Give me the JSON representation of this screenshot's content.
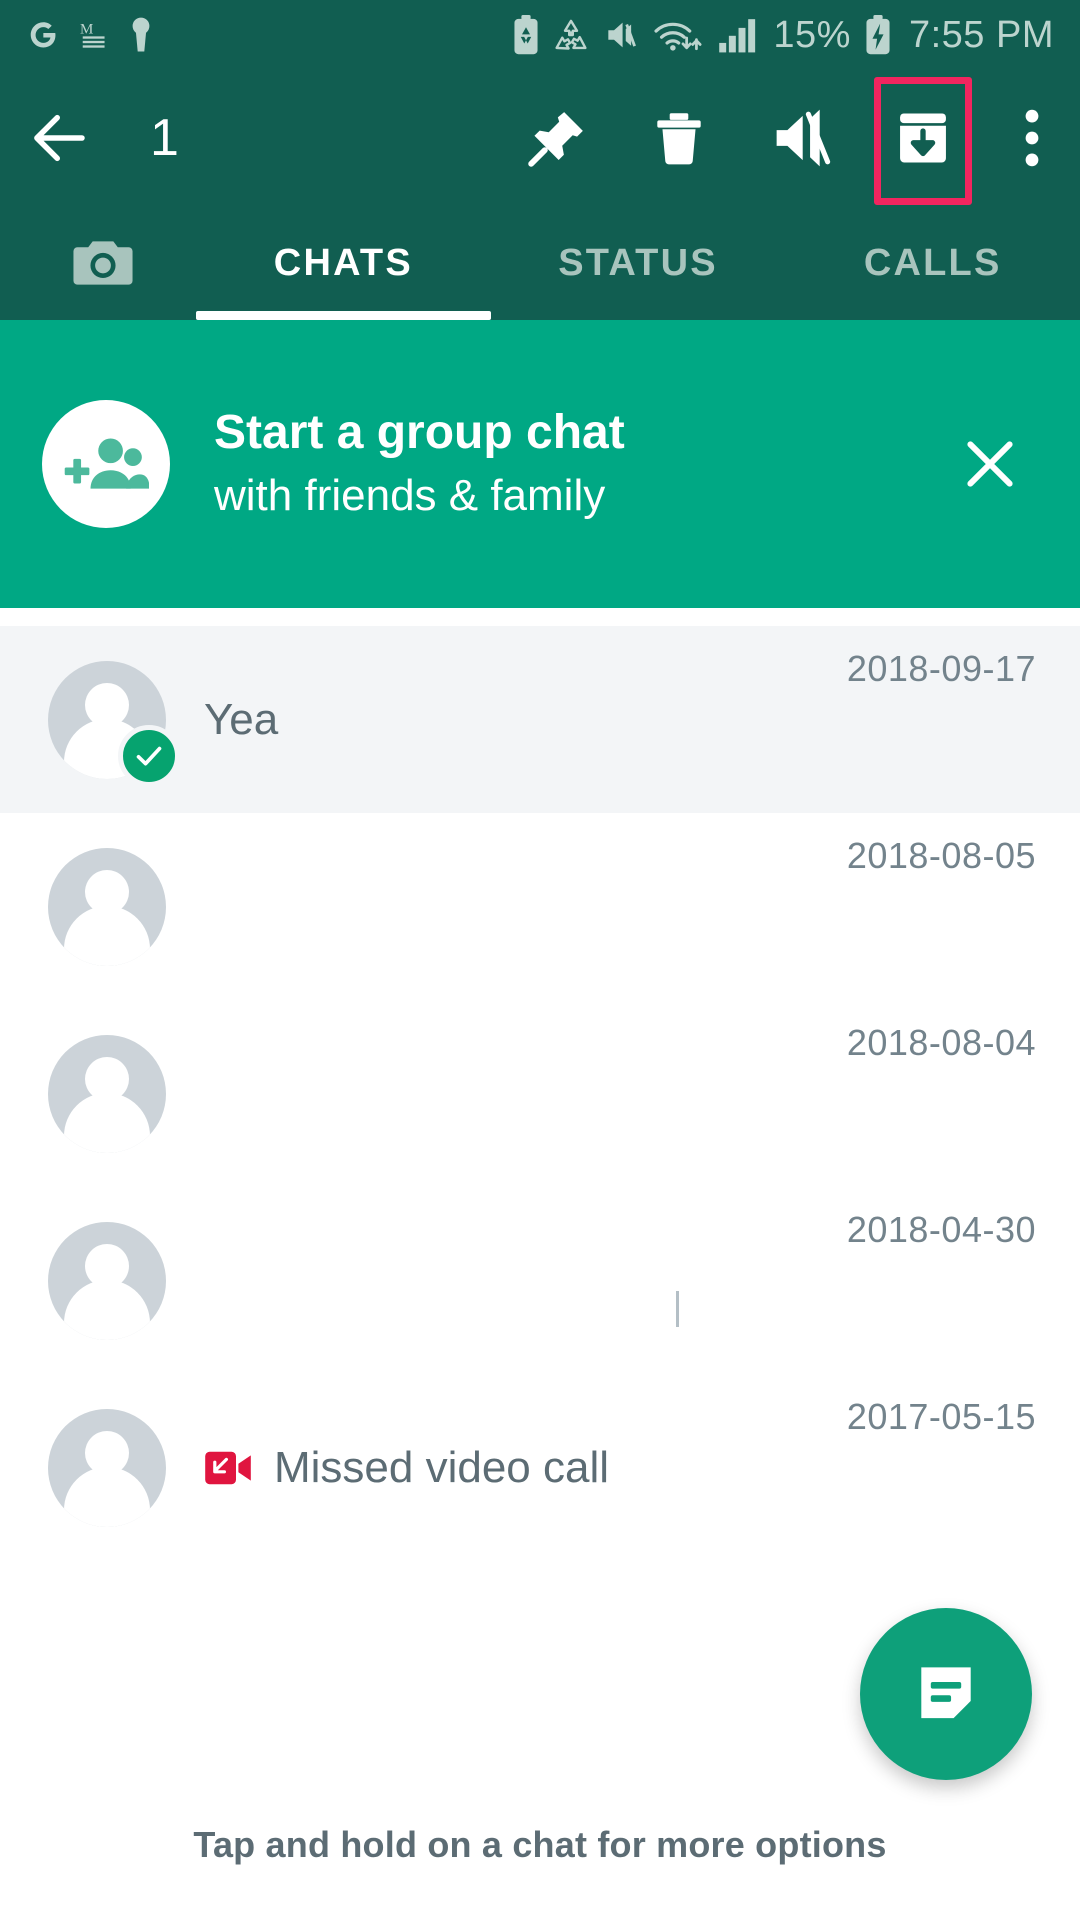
{
  "status_bar": {
    "left_icons": [
      "google-icon",
      "gmail-icon",
      "keyhole-icon"
    ],
    "right_icons": [
      "battery-saver-icon",
      "data-saver-icon",
      "mute-icon",
      "wifi-icon",
      "signal-icon",
      "battery-charging-icon"
    ],
    "battery_percent": "15%",
    "time": "7:55 PM"
  },
  "toolbar": {
    "back_label": "back-arrow",
    "selected_count": "1",
    "actions": [
      {
        "name": "pin-icon",
        "highlighted": false
      },
      {
        "name": "delete-icon",
        "highlighted": false
      },
      {
        "name": "mute-icon",
        "highlighted": false
      },
      {
        "name": "archive-icon",
        "highlighted": true
      },
      {
        "name": "overflow-menu-icon",
        "highlighted": false
      }
    ],
    "highlight_color": "#f2255f"
  },
  "tabs": {
    "camera_icon": "camera-icon",
    "items": [
      {
        "label": "CHATS",
        "active": true
      },
      {
        "label": "STATUS",
        "active": false
      },
      {
        "label": "CALLS",
        "active": false
      }
    ]
  },
  "banner": {
    "icon": "add-group-icon",
    "title": "Start a group chat",
    "subtitle": "with friends & family",
    "close_icon": "close-icon",
    "background_color": "#00a884"
  },
  "chats": [
    {
      "title": "Yea",
      "date": "2018-09-17",
      "selected": true,
      "subtitle": "",
      "icon": ""
    },
    {
      "title": "",
      "date": "2018-08-05",
      "selected": false,
      "subtitle": "",
      "icon": ""
    },
    {
      "title": "",
      "date": "2018-08-04",
      "selected": false,
      "subtitle": "",
      "icon": ""
    },
    {
      "title": "",
      "date": "2018-04-30",
      "selected": false,
      "subtitle": "",
      "icon": ""
    },
    {
      "title": "",
      "date": "2017-05-15",
      "selected": false,
      "subtitle": "Missed video call",
      "icon": "missed-video-call-icon"
    }
  ],
  "fab": {
    "icon": "new-chat-icon",
    "color": "#0ea07a"
  },
  "hint": "Tap and hold on a chat for more options",
  "theme": {
    "app_bar": "#115e51",
    "accent": "#00a884",
    "selected_row": "#f3f5f7"
  }
}
